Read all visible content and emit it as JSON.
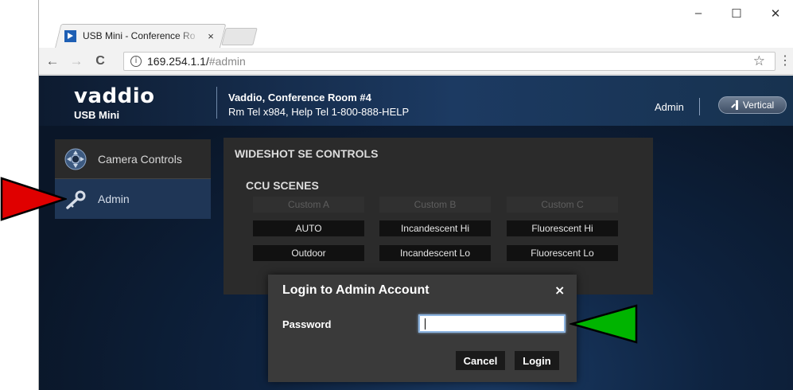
{
  "browser": {
    "tab_title": "USB Mini - Conference Ro",
    "tab_close": "×",
    "url_host": "169.254.1.1/",
    "url_path": "#admin",
    "minimize": "–",
    "maximize": "☐",
    "close": "✕",
    "back": "←",
    "forward": "→",
    "reload": "C",
    "info_glyph": "i",
    "star": "☆",
    "menu": "⋮"
  },
  "app": {
    "logo": "vaddio",
    "product": "USB Mini",
    "room_name": "Vaddio, Conference Room #4",
    "contact": "Rm Tel x984, Help Tel 1-800-888-HELP",
    "admin_link": "Admin",
    "vertical_button": "Vertical"
  },
  "sidebar": {
    "items": [
      {
        "label": "Camera Controls",
        "icon": "camera-controls-icon"
      },
      {
        "label": "Admin",
        "icon": "key-icon"
      }
    ]
  },
  "controls": {
    "title": "WIDESHOT SE CONTROLS",
    "subtitle": "CCU SCENES",
    "custom_scenes": [
      "Custom A",
      "Custom B",
      "Custom C"
    ],
    "preset_scenes_row1": [
      "AUTO",
      "Incandescent Hi",
      "Fluorescent Hi"
    ],
    "preset_scenes_row2": [
      "Outdoor",
      "Incandescent Lo",
      "Fluorescent Lo"
    ]
  },
  "login_dialog": {
    "title": "Login to Admin Account",
    "close": "×",
    "password_label": "Password",
    "password_value": "",
    "cancel_label": "Cancel",
    "login_label": "Login"
  },
  "colors": {
    "annotation_red": "#e00000",
    "annotation_green": "#00b400",
    "app_background": "#0e2340",
    "sidebar_active": "#1f3656"
  }
}
